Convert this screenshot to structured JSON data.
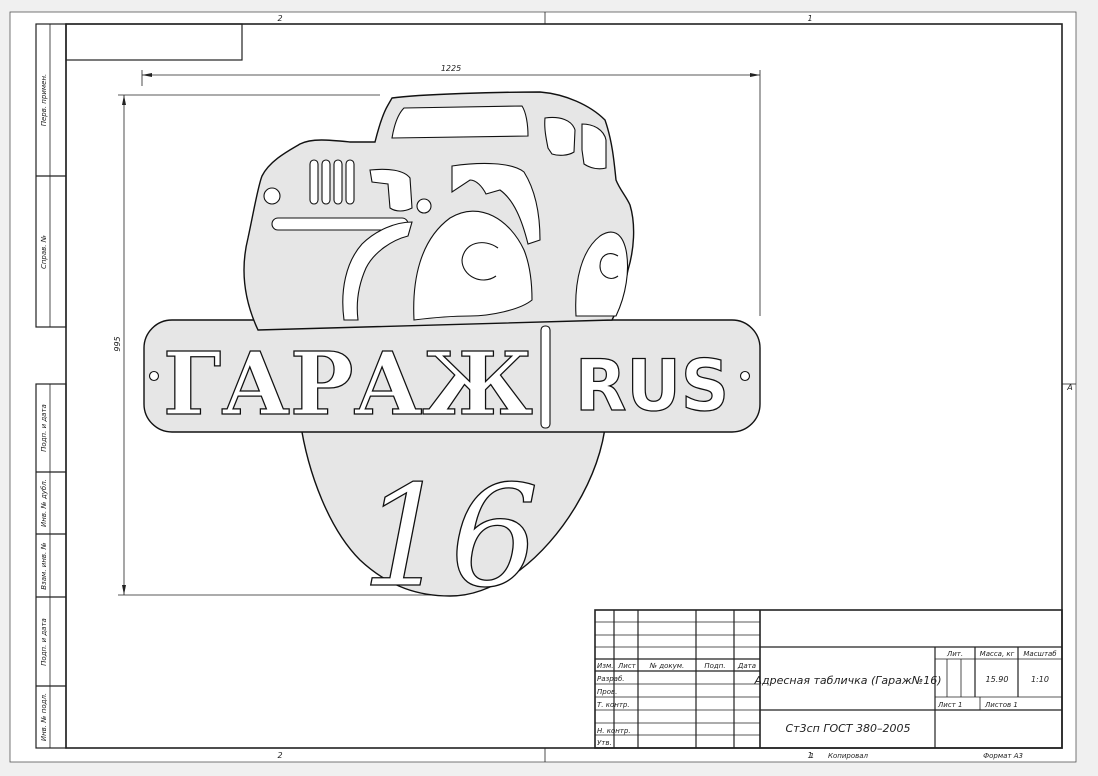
{
  "sheet": {
    "zone_top_left": "2",
    "zone_top_right": "1",
    "zone_bottom_left": "2",
    "zone_bottom_right": "1",
    "zone_side": "A"
  },
  "side_strip": {
    "labels": [
      "Перв. примен.",
      "Справ. №",
      "Подп. и дата",
      "Инв. № дубл.",
      "Взам. инв. №",
      "Подп. и дата",
      "Инв. № подл."
    ]
  },
  "dimensions": {
    "width": "1225",
    "height": "995"
  },
  "part": {
    "main_text": "ГАРАЖ",
    "country_text": "RUS",
    "number_text": "16",
    "fill_color": "#e6e6e6",
    "outline_color": "#111111"
  },
  "title_block": {
    "col_izm": "Изм.",
    "col_list": "Лист",
    "col_doc": "№ докум.",
    "col_sign": "Подп.",
    "col_date": "Дата",
    "row_razrab": "Разраб.",
    "row_prov": "Пров.",
    "row_tkontr": "Т. контр.",
    "row_nkontr": "Н. контр.",
    "row_utv": "Утв.",
    "title": "Адресная табличка (Гараж№16)",
    "material": "Ст3сп ГОСТ 380–2005",
    "lit_label": "Лит.",
    "mass_label": "Масса, кг",
    "scale_label": "Масштаб",
    "mass_value": "15.90",
    "scale_value": "1:10",
    "sheet_label": "Лист 1",
    "sheets_label": "Листов 1"
  },
  "footer": {
    "sheet_no": "1",
    "copied": "Копировал",
    "format": "Формат А3"
  }
}
